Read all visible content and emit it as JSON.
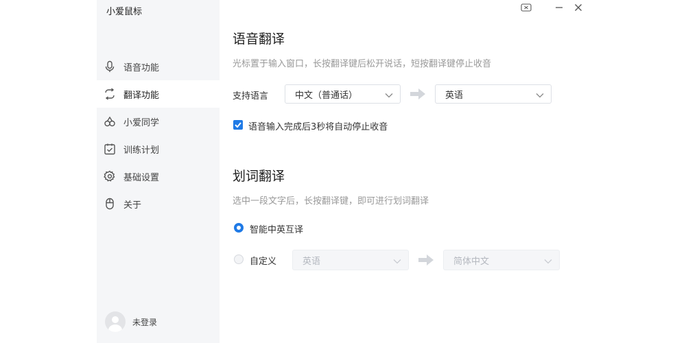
{
  "app": {
    "title": "小爱鼠标"
  },
  "sidebar": {
    "items": [
      {
        "label": "语音功能",
        "icon": "microphone-icon"
      },
      {
        "label": "翻译功能",
        "icon": "translate-icon",
        "active": true
      },
      {
        "label": "小爱同学",
        "icon": "xiaoai-icon"
      },
      {
        "label": "训练计划",
        "icon": "calendar-check-icon"
      },
      {
        "label": "基础设置",
        "icon": "gear-icon"
      },
      {
        "label": "关于",
        "icon": "mouse-icon"
      }
    ],
    "user": {
      "label": "未登录"
    }
  },
  "voice_translate": {
    "title": "语音翻译",
    "hint": "光标置于输入窗口，长按翻译键后松开说话，短按翻译键停止收音",
    "lang_label": "支持语言",
    "source_lang": "中文（普通话）",
    "target_lang": "英语",
    "auto_stop_checked": true,
    "auto_stop_label": "语音输入完成后3秒将自动停止收音"
  },
  "word_translate": {
    "title": "划词翻译",
    "hint": "选中一段文字后，长按翻译键，即可进行划词翻译",
    "smart_label": "智能中英互译",
    "smart_selected": true,
    "custom_label": "自定义",
    "custom_source": "英语",
    "custom_target": "简体中文"
  },
  "colors": {
    "accent": "#1f7ae6",
    "sidebar_bg": "#f5f6f8"
  }
}
